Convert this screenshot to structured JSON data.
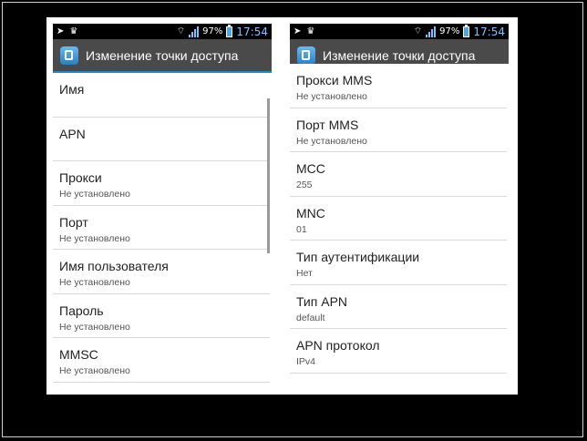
{
  "left_phone": {
    "status": {
      "battery": "97%",
      "time": "17:54"
    },
    "title": "Изменение точки доступа",
    "items": [
      {
        "title": "Имя",
        "sub": ""
      },
      {
        "title": "APN",
        "sub": ""
      },
      {
        "title": "Прокси",
        "sub": "Не установлено"
      },
      {
        "title": "Порт",
        "sub": "Не установлено"
      },
      {
        "title": "Имя пользователя",
        "sub": "Не установлено"
      },
      {
        "title": "Пароль",
        "sub": "Не установлено"
      },
      {
        "title": "MMSC",
        "sub": "Не установлено"
      }
    ]
  },
  "right_phone": {
    "status": {
      "battery": "97%",
      "time": "17:54"
    },
    "title": "Изменение точки доступа",
    "items": [
      {
        "title": "Прокси MMS",
        "sub": "Не установлено"
      },
      {
        "title": "Порт MMS",
        "sub": "Не установлено"
      },
      {
        "title": "MCC",
        "sub": "255"
      },
      {
        "title": "MNC",
        "sub": "01"
      },
      {
        "title": "Тип аутентификации",
        "sub": "Нет"
      },
      {
        "title": "Тип APN",
        "sub": "default"
      },
      {
        "title": "APN протокол",
        "sub": "IPv4"
      }
    ]
  },
  "icons": {
    "status_left": [
      "navigation-arrow-icon",
      "crown-icon"
    ],
    "status_right": [
      "wifi-icon",
      "signal-icon",
      "battery-icon"
    ],
    "actionbar": "apn-settings-icon"
  },
  "colors": {
    "accent": "#1e88c7",
    "actionbar": "#4a4a4a",
    "time": "#7ec3ff"
  }
}
